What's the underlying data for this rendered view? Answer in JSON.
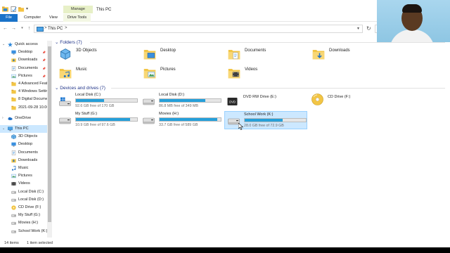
{
  "window": {
    "title": "This PC",
    "manage_label": "Manage",
    "tabs": [
      "File",
      "Computer",
      "View",
      "Drive Tools"
    ]
  },
  "address": {
    "path": "This PC",
    "separator": ">"
  },
  "nav_pane": {
    "items": [
      {
        "label": "Quick access",
        "icon": "star-icon",
        "pinned": false
      },
      {
        "label": "Desktop",
        "icon": "desktop-folder-icon",
        "pinned": true
      },
      {
        "label": "Downloads",
        "icon": "downloads-folder-icon",
        "pinned": true
      },
      {
        "label": "Documents",
        "icon": "documents-folder-icon",
        "pinned": true
      },
      {
        "label": "Pictures",
        "icon": "pictures-folder-icon",
        "pinned": true
      },
      {
        "label": "4 Advanced Feat",
        "icon": "folder-icon",
        "pinned": false
      },
      {
        "label": "4 Windows Settir",
        "icon": "folder-icon",
        "pinned": false
      },
      {
        "label": "8 Digital Docume",
        "icon": "folder-icon",
        "pinned": false
      },
      {
        "label": "2021-09-28 10.06",
        "icon": "folder-icon",
        "pinned": false
      },
      {
        "label": "OneDrive",
        "icon": "onedrive-icon",
        "pinned": false
      },
      {
        "label": "This PC",
        "icon": "this-pc-icon",
        "pinned": false
      },
      {
        "label": "3D Objects",
        "icon": "3d-objects-icon",
        "pinned": false
      },
      {
        "label": "Desktop",
        "icon": "desktop-folder-icon",
        "pinned": false
      },
      {
        "label": "Documents",
        "icon": "documents-folder-icon",
        "pinned": false
      },
      {
        "label": "Downloads",
        "icon": "downloads-folder-icon",
        "pinned": false
      },
      {
        "label": "Music",
        "icon": "music-folder-icon",
        "pinned": false
      },
      {
        "label": "Pictures",
        "icon": "pictures-folder-icon",
        "pinned": false
      },
      {
        "label": "Videos",
        "icon": "videos-folder-icon",
        "pinned": false
      },
      {
        "label": "Local Disk (C:)",
        "icon": "drive-icon",
        "pinned": false
      },
      {
        "label": "Local Disk (D:)",
        "icon": "drive-icon",
        "pinned": false
      },
      {
        "label": "CD Drive (F:)",
        "icon": "cd-drive-icon",
        "pinned": false
      },
      {
        "label": "My Stuff (G:)",
        "icon": "drive-icon",
        "pinned": false
      },
      {
        "label": "Movies (H:)",
        "icon": "drive-icon",
        "pinned": false
      },
      {
        "label": "School Work (K:)",
        "icon": "drive-icon",
        "pinned": false
      }
    ]
  },
  "folders_section": {
    "title": "Folders (7)",
    "items": [
      {
        "label": "3D Objects",
        "icon": "3d-objects-icon"
      },
      {
        "label": "Desktop",
        "icon": "desktop-folder-icon"
      },
      {
        "label": "Documents",
        "icon": "documents-folder-icon"
      },
      {
        "label": "Downloads",
        "icon": "downloads-folder-icon"
      },
      {
        "label": "Music",
        "icon": "music-folder-icon"
      },
      {
        "label": "Pictures",
        "icon": "pictures-folder-icon"
      },
      {
        "label": "Videos",
        "icon": "videos-folder-icon"
      }
    ]
  },
  "drives_section": {
    "title": "Devices and drives (7)",
    "items": [
      {
        "label": "Local Disk (C:)",
        "free": "92.6 GB free of 170 GB",
        "used_fraction": 0.46,
        "icon": "windows-drive-icon",
        "has_bar": true
      },
      {
        "label": "Local Disk (D:)",
        "free": "86.8 MB free of 349 MB",
        "used_fraction": 0.75,
        "icon": "drive-icon",
        "has_bar": true
      },
      {
        "label": "DVD RW Drive (E:)",
        "free": "",
        "used_fraction": 0,
        "icon": "dvd-drive-icon",
        "has_bar": false
      },
      {
        "label": "CD Drive (F:)",
        "free": "",
        "used_fraction": 0,
        "icon": "cd-drive-icon",
        "has_bar": false
      },
      {
        "label": "My Stuff (G:)",
        "free": "10.9 GB free of 97.6 GB",
        "used_fraction": 0.89,
        "icon": "drive-icon",
        "has_bar": true
      },
      {
        "label": "Movies (H:)",
        "free": "33.7 GB free of 589 GB",
        "used_fraction": 0.94,
        "icon": "drive-icon",
        "has_bar": true
      },
      {
        "label": "School Work (K:)",
        "free": "28.0 GB free of 72.9 GB",
        "used_fraction": 0.62,
        "icon": "drive-icon",
        "has_bar": true,
        "selected": true
      }
    ]
  },
  "status_bar": {
    "count": "14 items",
    "selected": "1 item selected"
  },
  "colors": {
    "accent": "#1a73c9",
    "bar_fill": "#26a0da",
    "selection": "#cce8ff",
    "section_title": "#1e3287"
  }
}
